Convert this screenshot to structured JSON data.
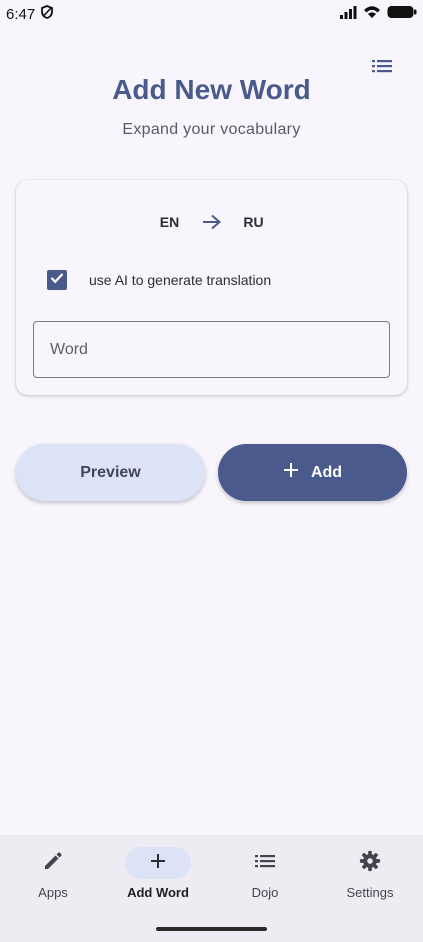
{
  "status_bar": {
    "time": "6:47"
  },
  "header": {
    "title": "Add New Word",
    "subtitle": "Expand your vocabulary"
  },
  "card": {
    "source_lang": "EN",
    "target_lang": "RU",
    "ai_label": "use AI to generate translation",
    "ai_checked": true,
    "word_placeholder": "Word"
  },
  "actions": {
    "preview_label": "Preview",
    "add_label": "Add"
  },
  "bottom_nav": {
    "items": [
      {
        "label": "Apps",
        "icon": "pencil-icon",
        "active": false
      },
      {
        "label": "Add Word",
        "icon": "plus-icon",
        "active": true
      },
      {
        "label": "Dojo",
        "icon": "list-icon",
        "active": false
      },
      {
        "label": "Settings",
        "icon": "gear-icon",
        "active": false
      }
    ]
  },
  "colors": {
    "accent": "#4a5a8c",
    "accent_container": "#dde3f6",
    "background": "#f8f5fc",
    "nav_background": "#eeebf3"
  }
}
